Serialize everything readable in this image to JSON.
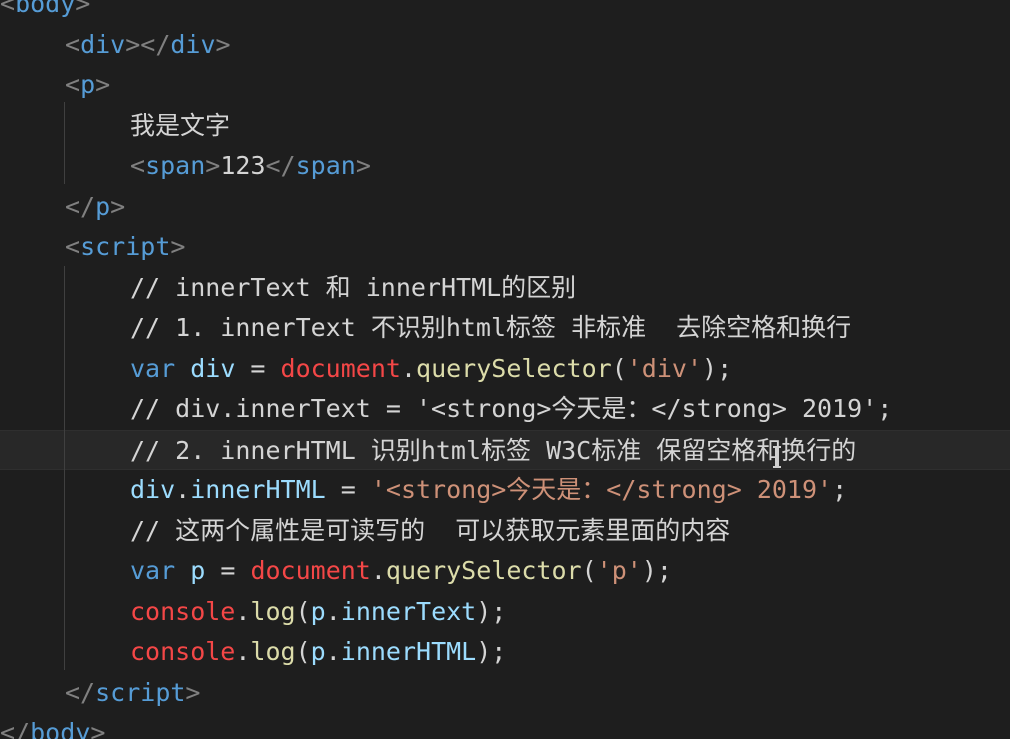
{
  "editor": {
    "colors": {
      "background": "#1e1e1e",
      "tag": "#569cd6",
      "angle": "#808080",
      "text": "#d4d4d4",
      "comment": "#d4d4d4",
      "keyword": "#569cd6",
      "variable": "#9cdcfe",
      "object": "#f44747",
      "method": "#dcdcaa",
      "string": "#ce9178",
      "punct": "#d4d4d4"
    },
    "lines": [
      {
        "indent": 0,
        "segments": [
          {
            "t": "<",
            "c": "angle"
          },
          {
            "t": "body",
            "c": "tag"
          },
          {
            "t": ">",
            "c": "angle"
          }
        ]
      },
      {
        "indent": 1,
        "segments": [
          {
            "t": "<",
            "c": "angle"
          },
          {
            "t": "div",
            "c": "tag"
          },
          {
            "t": "></",
            "c": "angle"
          },
          {
            "t": "div",
            "c": "tag"
          },
          {
            "t": ">",
            "c": "angle"
          }
        ]
      },
      {
        "indent": 1,
        "segments": [
          {
            "t": "<",
            "c": "angle"
          },
          {
            "t": "p",
            "c": "tag"
          },
          {
            "t": ">",
            "c": "angle"
          }
        ]
      },
      {
        "indent": 2,
        "segments": [
          {
            "t": "我是文字",
            "c": "text"
          }
        ]
      },
      {
        "indent": 2,
        "segments": [
          {
            "t": "<",
            "c": "angle"
          },
          {
            "t": "span",
            "c": "tag"
          },
          {
            "t": ">",
            "c": "angle"
          },
          {
            "t": "123",
            "c": "text"
          },
          {
            "t": "</",
            "c": "angle"
          },
          {
            "t": "span",
            "c": "tag"
          },
          {
            "t": ">",
            "c": "angle"
          }
        ]
      },
      {
        "indent": 1,
        "segments": [
          {
            "t": "</",
            "c": "angle"
          },
          {
            "t": "p",
            "c": "tag"
          },
          {
            "t": ">",
            "c": "angle"
          }
        ]
      },
      {
        "indent": 1,
        "segments": [
          {
            "t": "<",
            "c": "angle"
          },
          {
            "t": "script",
            "c": "tag"
          },
          {
            "t": ">",
            "c": "angle"
          }
        ]
      },
      {
        "indent": 2,
        "segments": [
          {
            "t": "// innerText 和 innerHTML的区别",
            "c": "comment"
          }
        ]
      },
      {
        "indent": 2,
        "segments": [
          {
            "t": "// 1. innerText 不识别html标签 非标准  去除空格和换行",
            "c": "comment"
          }
        ]
      },
      {
        "indent": 2,
        "segments": [
          {
            "t": "var",
            "c": "keyword"
          },
          {
            "t": " ",
            "c": "punct"
          },
          {
            "t": "div",
            "c": "variable"
          },
          {
            "t": " = ",
            "c": "punct"
          },
          {
            "t": "document",
            "c": "object"
          },
          {
            "t": ".",
            "c": "punct"
          },
          {
            "t": "querySelector",
            "c": "method"
          },
          {
            "t": "(",
            "c": "punct"
          },
          {
            "t": "'div'",
            "c": "string"
          },
          {
            "t": ");",
            "c": "punct"
          }
        ]
      },
      {
        "indent": 2,
        "segments": [
          {
            "t": "// div.innerText = '<strong>今天是：</strong> 2019';",
            "c": "comment"
          }
        ]
      },
      {
        "indent": 2,
        "current": true,
        "segments": [
          {
            "t": "// 2. innerHTML 识别html标签 W3C标准 保留空格和换行的",
            "c": "comment"
          }
        ]
      },
      {
        "indent": 2,
        "segments": [
          {
            "t": "div",
            "c": "variable"
          },
          {
            "t": ".",
            "c": "punct"
          },
          {
            "t": "innerHTML",
            "c": "variable"
          },
          {
            "t": " = ",
            "c": "punct"
          },
          {
            "t": "'<strong>今天是：</strong> 2019'",
            "c": "string"
          },
          {
            "t": ";",
            "c": "punct"
          }
        ]
      },
      {
        "indent": 2,
        "segments": [
          {
            "t": "// 这两个属性是可读写的  可以获取元素里面的内容",
            "c": "comment"
          }
        ]
      },
      {
        "indent": 2,
        "segments": [
          {
            "t": "var",
            "c": "keyword"
          },
          {
            "t": " ",
            "c": "punct"
          },
          {
            "t": "p",
            "c": "variable"
          },
          {
            "t": " = ",
            "c": "punct"
          },
          {
            "t": "document",
            "c": "object"
          },
          {
            "t": ".",
            "c": "punct"
          },
          {
            "t": "querySelector",
            "c": "method"
          },
          {
            "t": "(",
            "c": "punct"
          },
          {
            "t": "'p'",
            "c": "string"
          },
          {
            "t": ");",
            "c": "punct"
          }
        ]
      },
      {
        "indent": 2,
        "segments": [
          {
            "t": "console",
            "c": "object"
          },
          {
            "t": ".",
            "c": "punct"
          },
          {
            "t": "log",
            "c": "method"
          },
          {
            "t": "(",
            "c": "punct"
          },
          {
            "t": "p",
            "c": "variable"
          },
          {
            "t": ".",
            "c": "punct"
          },
          {
            "t": "innerText",
            "c": "variable"
          },
          {
            "t": ");",
            "c": "punct"
          }
        ]
      },
      {
        "indent": 2,
        "segments": [
          {
            "t": "console",
            "c": "object"
          },
          {
            "t": ".",
            "c": "punct"
          },
          {
            "t": "log",
            "c": "method"
          },
          {
            "t": "(",
            "c": "punct"
          },
          {
            "t": "p",
            "c": "variable"
          },
          {
            "t": ".",
            "c": "punct"
          },
          {
            "t": "innerHTML",
            "c": "variable"
          },
          {
            "t": ");",
            "c": "punct"
          }
        ]
      },
      {
        "indent": 1,
        "segments": [
          {
            "t": "</",
            "c": "angle"
          },
          {
            "t": "script",
            "c": "tag"
          },
          {
            "t": ">",
            "c": "angle"
          }
        ]
      },
      {
        "indent": 0,
        "segments": [
          {
            "t": "</",
            "c": "angle"
          },
          {
            "t": "body",
            "c": "tag"
          },
          {
            "t": ">",
            "c": "angle"
          }
        ]
      }
    ]
  }
}
